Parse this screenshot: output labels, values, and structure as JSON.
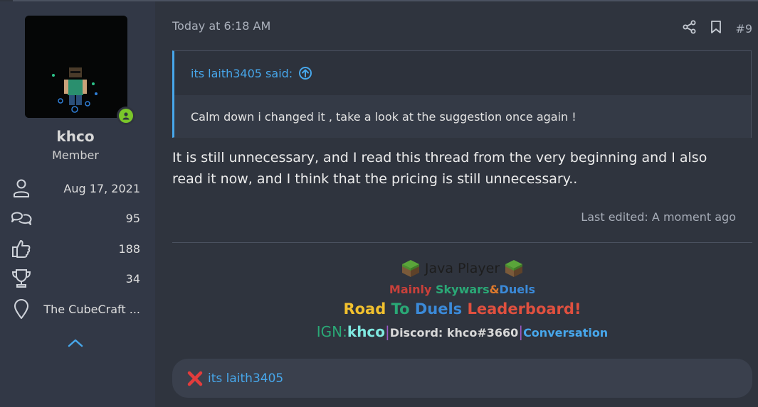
{
  "user": {
    "name": "khco",
    "title": "Member",
    "stats": [
      {
        "icon": "user-icon",
        "value": "Aug 17, 2021"
      },
      {
        "icon": "messages-icon",
        "value": "95"
      },
      {
        "icon": "thumbs-up-icon",
        "value": "188"
      },
      {
        "icon": "trophy-icon",
        "value": "34"
      },
      {
        "icon": "location-icon",
        "value": "The CubeCraft ..."
      }
    ]
  },
  "post": {
    "date": "Today at 6:18 AM",
    "number": "#9",
    "quote": {
      "author": "its laith3405 said:",
      "text": "Calm down i changed it , take a look at the suggestion once again !"
    },
    "message": "It is still unnecessary, and I read this thread from the very beginning and I also read it now, and I think that the pricing is still unnecessary..",
    "last_edited": "Last edited: A moment ago"
  },
  "signature": {
    "line1": "Java Player",
    "line2": {
      "a": "Mainly ",
      "b": "Skywars",
      "c": "&",
      "d": "Duels"
    },
    "line3": {
      "a": "Road ",
      "b": "To ",
      "c": "Duels ",
      "d": "Leaderboard!"
    },
    "line4": {
      "ign_label": "IGN: ",
      "ign": "khco",
      "sep1": " |",
      "discord": "Discord: khco#3660",
      "sep2": "| ",
      "conv": "Conversation"
    }
  },
  "reactions": {
    "names": "its laith3405"
  },
  "colors": {
    "accent": "#47a7eb",
    "online": "#7ac62a",
    "red": "#d0433a",
    "yellow": "#f2c12e",
    "green": "#2aa876",
    "blue": "#3b8ad9"
  }
}
